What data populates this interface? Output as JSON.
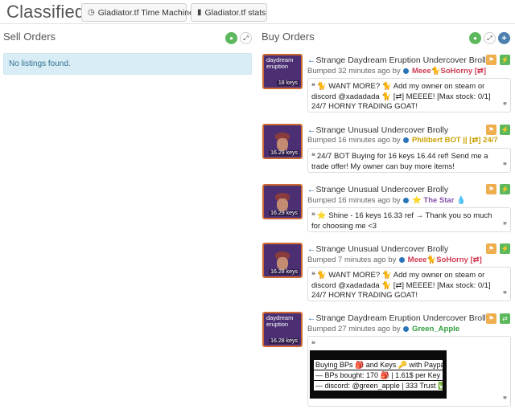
{
  "header": {
    "title": "Classifieds",
    "buttons": [
      {
        "label": "Gladiator.tf Time Machine",
        "icon": "clock-icon"
      },
      {
        "label": "Gladiator.tf stats",
        "icon": "bar-chart-icon"
      }
    ]
  },
  "sell": {
    "title": "Sell Orders",
    "empty_text": "No listings found."
  },
  "buy": {
    "title": "Buy Orders",
    "listings": [
      {
        "thumb_text": "daydream eruption",
        "price": "18 keys",
        "name": "Strange Daydream Eruption Undercover Brolly",
        "bumped": "Bumped 32 minutes ago by",
        "user": "Meee🐈SoHorny [⇄]",
        "user_color": "#cf3b52",
        "message": "🐈 WANT MORE? 🐈 Add my owner on steam or discord @xadadada 🐈 [⇄] MEEEE! [Max stock: 0/1] 24/7 HORNY TRADING GOAT!",
        "action": "⚡"
      },
      {
        "thumb_text": "",
        "price": "16.29 keys",
        "name": "Strange Unusual Undercover Brolly",
        "bumped": "Bumped 16 minutes ago by",
        "user": "Philibert BOT || [⇄] 24/7",
        "user_color": "#c9a000",
        "message": "24/7 BOT Buying for 16 keys 16.44 ref! Send me a trade offer! My owner can buy more items!",
        "action": "⚡"
      },
      {
        "thumb_text": "",
        "price": "16.29 keys",
        "name": "Strange Unusual Undercover Brolly",
        "bumped": "Bumped 16 minutes ago by",
        "user": "⭐ The Star 💧",
        "user_color": "#8650ac",
        "message": "⭐ Shine - 16 keys 16.33 ref → Thank you so much for choosing me <3",
        "action": "⚡"
      },
      {
        "thumb_text": "",
        "price": "16.28 keys",
        "name": "Strange Unusual Undercover Brolly",
        "bumped": "Bumped 7 minutes ago by",
        "user": "Meee🐈SoHorny [⇄]",
        "user_color": "#cf3b52",
        "message": "🐈 WANT MORE? 🐈 Add my owner on steam or discord @xadadada 🐈 [⇄] MEEEE! [Max stock: 0/1] 24/7 HORNY TRADING GOAT!",
        "action": "⚡"
      },
      {
        "thumb_text": "daydream eruption",
        "price": "16.28 keys",
        "name": "Strange Daydream Eruption Undercover Brolly",
        "bumped": "Bumped 27 minutes ago by",
        "user": "Green_Apple",
        "user_color": "#2e9e3e",
        "message_lines": [
          "Buying BPs 🎒 and Keys 🔑 with Paypal",
          "— BPs bought: 170 🎒 | 1.61$ per Key",
          "— discord: @green_apple | 333 Trust ✅"
        ],
        "action": "⇄"
      }
    ]
  }
}
